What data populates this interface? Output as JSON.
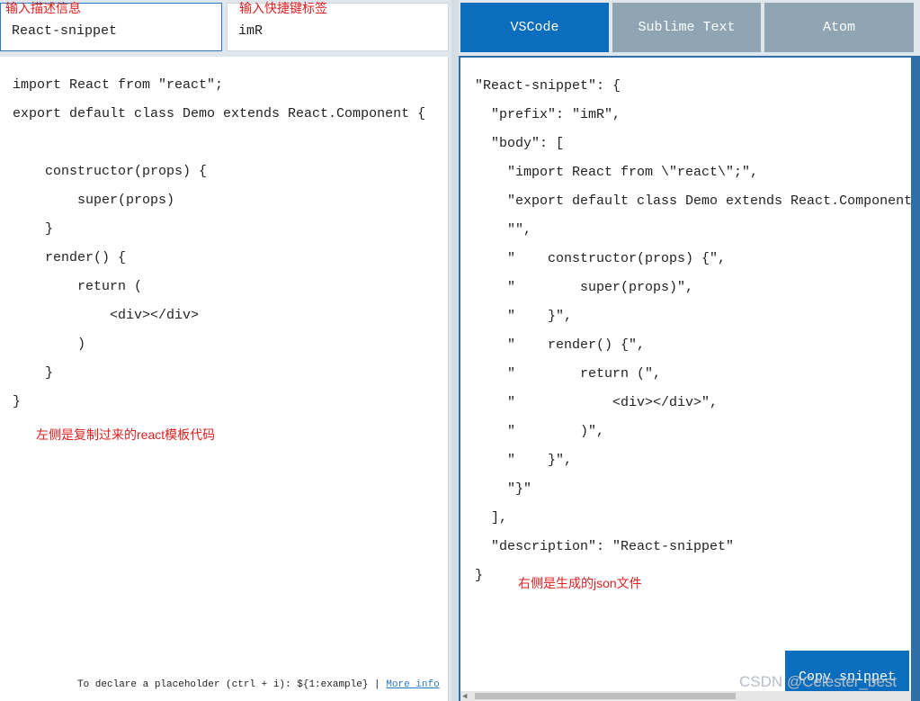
{
  "inputs": {
    "description_value": "React-snippet",
    "prefix_value": "imR"
  },
  "annotations": {
    "description_label": "输入描述信息",
    "prefix_label": "输入快捷键标签",
    "left_note": "左侧是复制过来的react模板代码",
    "right_note": "右侧是生成的json文件"
  },
  "left_code": [
    "import React from \"react\";",
    "export default class Demo extends React.Component {",
    "",
    "    constructor(props) {",
    "        super(props)",
    "    }",
    "    render() {",
    "        return (",
    "            <div></div>",
    "        )",
    "    }",
    "}"
  ],
  "footer": {
    "hint": "To declare a placeholder (ctrl + i): ${1:example} | ",
    "link": "More info"
  },
  "tabs": [
    {
      "label": "VSCode",
      "active": true
    },
    {
      "label": "Sublime Text",
      "active": false
    },
    {
      "label": "Atom",
      "active": false
    }
  ],
  "right_code": [
    "\"React-snippet\": {",
    "  \"prefix\": \"imR\",",
    "  \"body\": [",
    "    \"import React from \\\"react\\\";\",",
    "    \"export default class Demo extends React.Component {\",",
    "    \"\",",
    "    \"    constructor(props) {\",",
    "    \"        super(props)\",",
    "    \"    }\",",
    "    \"    render() {\",",
    "    \"        return (\",",
    "    \"            <div></div>\",",
    "    \"        )\",",
    "    \"    }\",",
    "    \"}\"",
    "  ],",
    "  \"description\": \"React-snippet\"",
    "}"
  ],
  "copy_button_label": "Copy snippet",
  "watermark": "CSDN @Celester_best",
  "colors": {
    "accent": "#0a6dbd",
    "inactive_tab": "#8fa5b4",
    "annotation_red": "#e02020"
  }
}
